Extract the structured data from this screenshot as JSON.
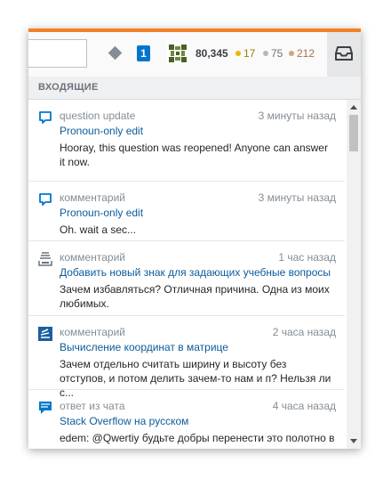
{
  "topbar": {
    "reputation": "80,345",
    "review_count": "1",
    "badges": {
      "gold": {
        "count": "17",
        "color": "#f1b600"
      },
      "silver": {
        "count": "75",
        "color": "#b4b8bc"
      },
      "bronze": {
        "count": "212",
        "color": "#d1a684"
      }
    },
    "icons": [
      "diamond-icon",
      "avatar-identicon",
      "inbox-icon"
    ]
  },
  "inbox": {
    "title": "ВХОДЯЩИЕ",
    "items": [
      {
        "icon": "comment-bubble-icon",
        "type": "question update",
        "time": "3 минуты назад",
        "title": "Pronoun-only edit",
        "body": "Hooray, this question was reopened! Anyone can answer it now."
      },
      {
        "icon": "comment-bubble-icon",
        "type": "комментарий",
        "time": "3 минуты назад",
        "title": "Pronoun-only edit",
        "body": "Oh. wait a sec..."
      },
      {
        "icon": "stackexchange-meta-icon",
        "type": "комментарий",
        "time": "1 час назад",
        "title": "Добавить новый знак для задающих учебные вопросы",
        "body": "Зачем избавляться? Отличная причина. Одна из моих любимых."
      },
      {
        "icon": "stackoverflow-ru-icon",
        "type": "комментарий",
        "time": "2 часа назад",
        "title": "Вычисление координат в матрице",
        "body": "Зачем отдельно считать ширину и высоту без отступов, и потом делить зачем-то нам и п? Нельзя ли с..."
      },
      {
        "icon": "chat-icon",
        "type": "ответ из чата",
        "time": "4 часа назад",
        "title": "Stack Overflow на русском",
        "body": "edem: @Qwertiy будьте добры перенести это полотно в "
      }
    ]
  },
  "colors": {
    "accent": "#f48024",
    "link": "#0c5b9b",
    "review": "#0077cc"
  }
}
